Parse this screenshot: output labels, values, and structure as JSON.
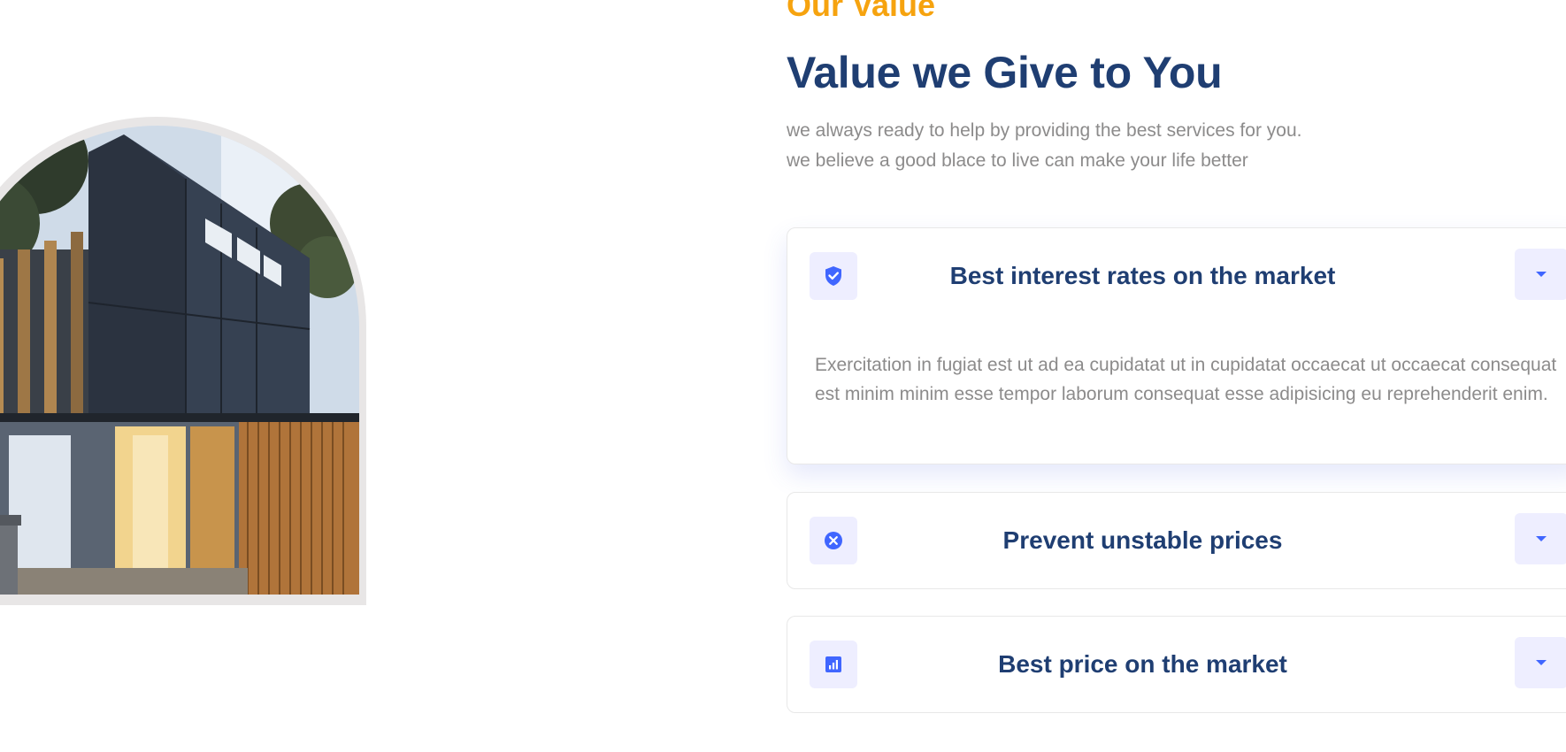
{
  "section": {
    "eyebrow": "Our Value",
    "headline": "Value we Give to You",
    "subtext_lines": [
      "we always ready to help by providing the best services for you.",
      "we believe a good blace to live can make your life better"
    ]
  },
  "accordion": {
    "items": [
      {
        "title": "Best interest rates on the market",
        "icon": "shield-check-icon",
        "expanded": true,
        "body": "Exercitation in fugiat est ut ad ea cupidatat ut in cupidatat occaecat ut occaecat consequat est minim minim esse tempor laborum consequat esse adipisicing eu reprehenderit enim."
      },
      {
        "title": "Prevent unstable prices",
        "icon": "close-circle-icon",
        "expanded": false
      },
      {
        "title": "Best price on the market",
        "icon": "bar-chart-icon",
        "expanded": false
      }
    ],
    "toggle_icon": "caret-down-icon"
  },
  "colors": {
    "accent_orange": "#f6a30f",
    "heading_navy": "#1f3e72",
    "body_gray": "#8c8b8b",
    "icon_blue": "#4066ff",
    "icon_bg": "#eeeeff"
  }
}
